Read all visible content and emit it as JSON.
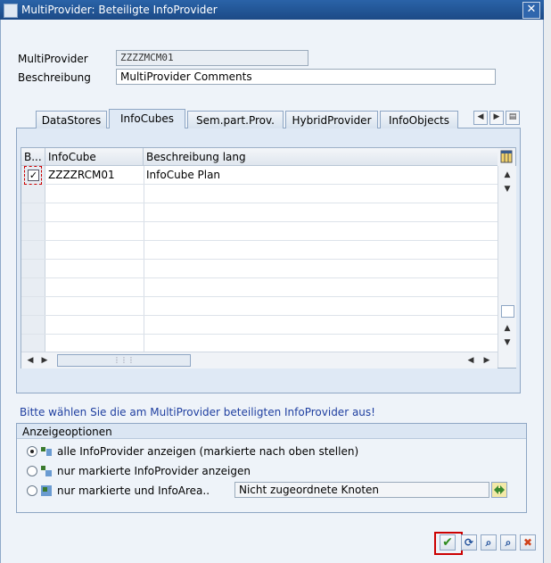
{
  "window": {
    "title": "MultiProvider: Beteiligte InfoProvider",
    "close_glyph": "✕"
  },
  "form": {
    "multiprovider_label": "MultiProvider",
    "multiprovider_value": "ZZZZMCM01",
    "beschreibung_label": "Beschreibung",
    "beschreibung_value": "MultiProvider Comments"
  },
  "tabs": [
    {
      "label": "DataStores",
      "active": false
    },
    {
      "label": "InfoCubes",
      "active": true
    },
    {
      "label": "Sem.part.Prov.",
      "active": false
    },
    {
      "label": "HybridProvider",
      "active": false
    },
    {
      "label": "InfoObjects",
      "active": false
    }
  ],
  "table": {
    "columns": [
      "B...",
      "InfoCube",
      "Beschreibung lang"
    ],
    "rows": [
      {
        "checked": true,
        "infocube": "ZZZZRCM01",
        "beschreibung": "InfoCube Plan"
      }
    ],
    "check_glyph": "✓"
  },
  "hint": "Bitte wählen Sie die am MultiProvider beteiligten InfoProvider aus!",
  "options": {
    "title": "Anzeigeoptionen",
    "items": [
      {
        "label": "alle InfoProvider anzeigen (markierte nach oben stellen)",
        "selected": true
      },
      {
        "label": "nur markierte InfoProvider anzeigen",
        "selected": false
      },
      {
        "label": "nur markierte und InfoArea..",
        "selected": false
      }
    ],
    "infoarea_value": "Nicht zugeordnete Knoten"
  },
  "colors": {
    "titlebar": "#1c4a86",
    "hint": "#1f3fa0",
    "highlight": "#cc0000",
    "ok": "#2e8b1e",
    "cancel": "#d0421b"
  },
  "icons": [
    "window-menu-icon",
    "close-icon",
    "tab-scroll-left-icon",
    "tab-scroll-right-icon",
    "tab-list-icon",
    "column-layout-icon",
    "ok-check-icon",
    "refresh-icon",
    "find-icon",
    "find-next-icon",
    "cancel-icon"
  ]
}
